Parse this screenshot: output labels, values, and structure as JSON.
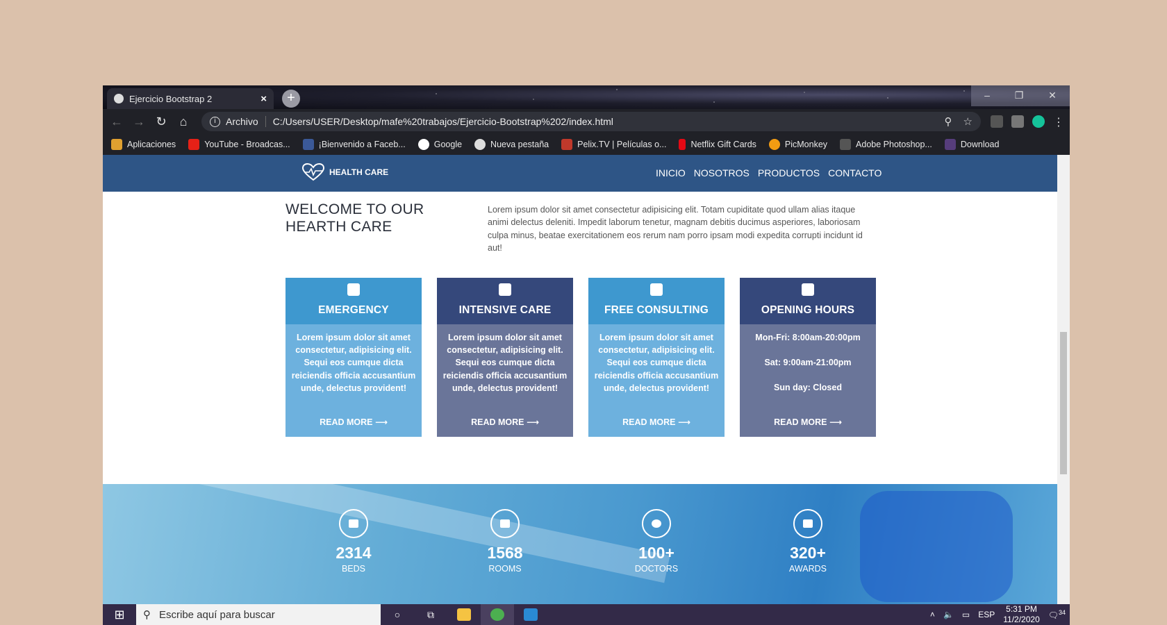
{
  "browser": {
    "tab_title": "Ejercicio Bootstrap 2",
    "tab_close": "×",
    "new_tab": "+",
    "scheme_label": "Archivo",
    "url": "C:/Users/USER/Desktop/mafe%20trabajos/Ejercicio-Bootstrap%202/index.html",
    "bookmarks": [
      {
        "label": "Aplicaciones",
        "color": "#e0a030"
      },
      {
        "label": "YouTube - Broadcas...",
        "color": "#e62117"
      },
      {
        "label": "¡Bienvenido a Faceb...",
        "color": "#3b5998"
      },
      {
        "label": "Google",
        "color": "#ffffff"
      },
      {
        "label": "Nueva pestaña",
        "color": "#dddddd"
      },
      {
        "label": "Pelix.TV | Películas o...",
        "color": "#c0392b"
      },
      {
        "label": "Netflix Gift Cards",
        "color": "#e50914"
      },
      {
        "label": "PicMonkey",
        "color": "#f39c12"
      },
      {
        "label": "Adobe Photoshop...",
        "color": "#555555"
      },
      {
        "label": "Download",
        "color": "#563d7c"
      }
    ]
  },
  "site": {
    "brand": "HEALTH CARE",
    "nav": [
      "INICIO",
      "NOSOTROS",
      "PRODUCTOS",
      "CONTACTO"
    ],
    "welcome_line1": "WELCOME TO OUR",
    "welcome_line2": "HEARTH CARE",
    "intro": "Lorem ipsum dolor sit amet consectetur adipisicing elit. Totam cupiditate quod ullam alias itaque animi delectus deleniti. Impedit laborum tenetur, magnam debitis ducimus asperiores, laboriosam culpa minus, beatae exercitationem eos rerum nam porro ipsam modi expedita corrupti incidunt id aut!",
    "cards": [
      {
        "title": "EMERGENCY",
        "text": "Lorem ipsum dolor sit amet consectetur, adipisicing elit. Sequi eos cumque dicta reiciendis officia accusantium unde, delectus provident!",
        "more": "READ MORE ⟶"
      },
      {
        "title": "INTENSIVE CARE",
        "text": "Lorem ipsum dolor sit amet consectetur, adipisicing elit. Sequi eos cumque dicta reiciendis officia accusantium unde, delectus provident!",
        "more": "READ MORE ⟶"
      },
      {
        "title": "FREE CONSULTING",
        "text": "Lorem ipsum dolor sit amet consectetur, adipisicing elit. Sequi eos cumque dicta reiciendis officia accusantium unde, delectus provident!",
        "more": "READ MORE ⟶"
      },
      {
        "title": "OPENING HOURS",
        "hours": [
          "Mon-Fri: 8:00am-20:00pm",
          "Sat: 9:00am-21:00pm",
          "Sun day: Closed"
        ],
        "more": "READ MORE ⟶"
      }
    ],
    "stats": [
      {
        "value": "2314",
        "label": "BEDS"
      },
      {
        "value": "1568",
        "label": "ROOMS"
      },
      {
        "value": "100+",
        "label": "DOCTORS"
      },
      {
        "value": "320+",
        "label": "AWARDS"
      }
    ]
  },
  "taskbar": {
    "search_placeholder": "Escribe aquí para buscar",
    "language": "ESP",
    "time": "5:31 PM",
    "date": "11/2/2020",
    "notifications": "34"
  }
}
